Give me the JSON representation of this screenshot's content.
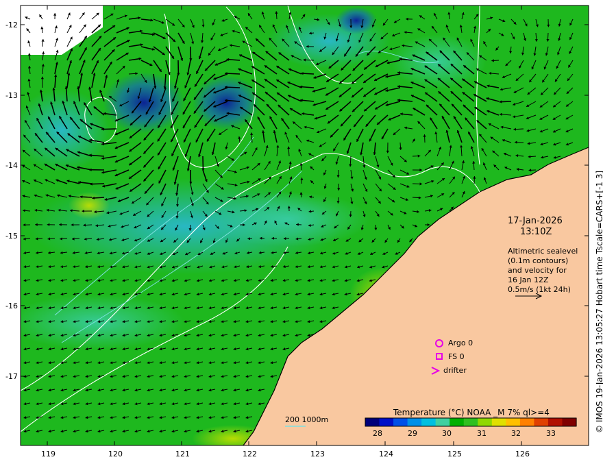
{
  "map": {
    "date": "17-Jan-2026",
    "time": "13:10Z",
    "notes": [
      "Altimetric sealevel",
      "(0.1m contours)",
      "and velocity for",
      "16 Jan 12Z",
      "0.5m/s (1kt 24h)"
    ],
    "credit": "© IMOS 19-Jan-2026 13:05:27 Hobart time Tscale=CARS+[-1 3]",
    "lat_ticks": [
      "-12",
      "-13",
      "-14",
      "-15",
      "-16",
      "-17"
    ],
    "lon_ticks": [
      "119",
      "120",
      "121",
      "122",
      "123",
      "124",
      "125",
      "126"
    ],
    "bathymetry_label": "200  1000m"
  },
  "legend": {
    "items": [
      {
        "label": "Argo 0",
        "symbol": "circle"
      },
      {
        "label": "FS 0",
        "symbol": "square"
      },
      {
        "label": "drifter",
        "symbol": "chevron"
      }
    ],
    "symbol_color": "#e600e6"
  },
  "colorbar": {
    "title": "Temperature (°C) NOAA _M 7% ql>=4",
    "ticks": [
      "28",
      "29",
      "30",
      "31",
      "32",
      "33"
    ],
    "colors": [
      "#00007a",
      "#0010c8",
      "#0050e8",
      "#0090e8",
      "#00c0e0",
      "#40d0a0",
      "#00b000",
      "#30c020",
      "#90d800",
      "#e0e000",
      "#ffc000",
      "#ff8000",
      "#e04000",
      "#b01000",
      "#800000"
    ]
  },
  "colors": {
    "land": "#f9c8a0",
    "sea": "#1eb81e",
    "sea_cool": "#3cc8c8",
    "contour": "#ffffff",
    "bathymetry": "#7fe0e0"
  }
}
